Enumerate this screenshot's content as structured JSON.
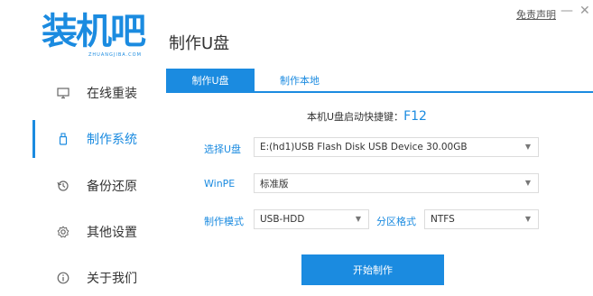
{
  "brand": {
    "logo_text": "装机吧",
    "logo_sub": "ZHUANGJIBA.COM",
    "color": "#1b8be0"
  },
  "window": {
    "disclaimer": "免责声明",
    "minimize": "—",
    "close": "✕"
  },
  "page_title": "制作U盘",
  "sidebar": {
    "items": [
      {
        "label": "在线重装",
        "icon": "monitor-icon",
        "active": false
      },
      {
        "label": "制作系统",
        "icon": "usb-icon",
        "active": true
      },
      {
        "label": "备份还原",
        "icon": "backup-icon",
        "active": false
      },
      {
        "label": "其他设置",
        "icon": "gear-icon",
        "active": false
      },
      {
        "label": "关于我们",
        "icon": "info-icon",
        "active": false
      }
    ]
  },
  "tabs": [
    {
      "label": "制作U盘",
      "active": true
    },
    {
      "label": "制作本地",
      "active": false
    }
  ],
  "hotkey": {
    "prefix": "本机U盘启动快捷键：",
    "key": "F12"
  },
  "form": {
    "usb_label": "选择U盘",
    "usb_value": "E:(hd1)USB Flash Disk USB Device 30.00GB",
    "winpe_label": "WinPE",
    "winpe_value": "标准版",
    "mode_label": "制作模式",
    "mode_value": "USB-HDD",
    "partition_label": "分区格式",
    "partition_value": "NTFS"
  },
  "start_button": "开始制作"
}
